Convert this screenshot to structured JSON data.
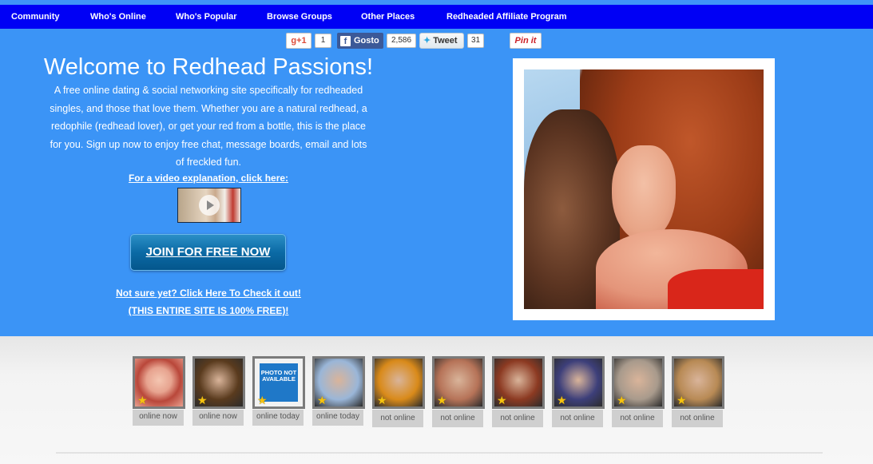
{
  "nav": {
    "items": [
      "Community",
      "Who's Online",
      "Who's Popular",
      "Browse Groups",
      "Other Places",
      "Redheaded Affiliate Program"
    ]
  },
  "social": {
    "gplus_label": "g+1",
    "gplus_count": "1",
    "facebook_label": "Gosto",
    "facebook_icon": "f",
    "facebook_count": "2,586",
    "twitter_label": "Tweet",
    "twitter_count": "31",
    "pinterest_label": "Pin it"
  },
  "hero": {
    "title": "Welcome to Redhead Passions!",
    "intro": "A free online dating & social networking site specifically for redheaded singles, and those that love them. Whether you are a natural redhead, a redophile (redhead lover), or get your red from a bottle, this is the place for you. Sign up now to enjoy free chat, message boards, email and lots of freckled fun.",
    "video_link": "For a video explanation, click here:",
    "join_button": "JOIN FOR FREE NOW",
    "check_link": "Not sure yet? Click Here To Check it out!",
    "free_link": "(THIS ENTIRE SITE IS 100% FREE)!"
  },
  "members": [
    {
      "status": "online now",
      "bg": "#e9a08f",
      "photo": "avatar"
    },
    {
      "status": "online now",
      "bg": "#5a3b1e",
      "photo": "photo"
    },
    {
      "status": "online today",
      "bg": "#ffffff",
      "photo": "not-available",
      "na_text": "PHOTO NOT AVAILABLE"
    },
    {
      "status": "online today",
      "bg": "#9ab6d8",
      "photo": "photo"
    },
    {
      "status": "not online",
      "bg": "#d98a1a",
      "photo": "photo"
    },
    {
      "status": "not online",
      "bg": "#b67358",
      "photo": "photo"
    },
    {
      "status": "not online",
      "bg": "#8c3a22",
      "photo": "photo"
    },
    {
      "status": "not online",
      "bg": "#3d3f7a",
      "photo": "photo"
    },
    {
      "status": "not online",
      "bg": "#a89a8c",
      "photo": "photo"
    },
    {
      "status": "not online",
      "bg": "#b88a55",
      "photo": "photo"
    }
  ],
  "colors": {
    "nav_bg": "#0000f5",
    "hero_bg": "#3b94f6",
    "join_button": "#0b6aa5",
    "star": "#f5c210"
  }
}
